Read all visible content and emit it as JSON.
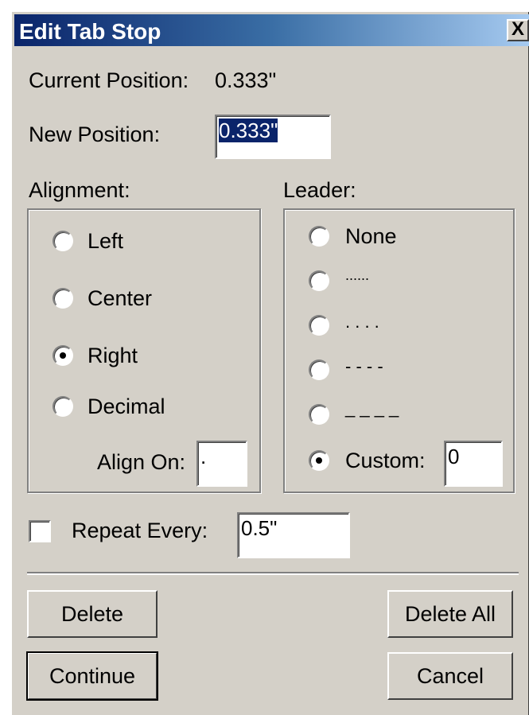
{
  "dialog": {
    "title": "Edit Tab Stop",
    "close_label": "X"
  },
  "current_position": {
    "label": "Current Position:",
    "value": "0.333\""
  },
  "new_position": {
    "label": "New Position:",
    "value": "0.333\""
  },
  "alignment": {
    "label": "Alignment:",
    "options": [
      "Left",
      "Center",
      "Right",
      "Decimal"
    ],
    "selected": "Right",
    "align_on_label": "Align On:",
    "align_on_value": "."
  },
  "leader": {
    "label": "Leader:",
    "options": [
      "None",
      "......",
      ". . . .",
      "- - - -",
      "_ _ _ _",
      "Custom:"
    ],
    "selected": "Custom:",
    "custom_value": "0"
  },
  "repeat": {
    "label": "Repeat Every:",
    "checked": false,
    "value": "0.5\""
  },
  "buttons": {
    "delete": "Delete",
    "delete_all": "Delete All",
    "continue": "Continue",
    "cancel": "Cancel"
  }
}
